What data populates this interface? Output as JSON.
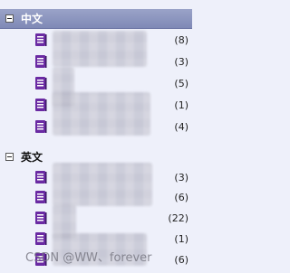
{
  "groups": [
    {
      "label": "中文",
      "selected": true,
      "items": [
        {
          "count": "(8)"
        },
        {
          "count": "(3)"
        },
        {
          "count": "(5)"
        },
        {
          "count": "(1)"
        },
        {
          "count": "(4)"
        }
      ]
    },
    {
      "label": "英文",
      "selected": false,
      "items": [
        {
          "count": "(3)"
        },
        {
          "count": "(6)"
        },
        {
          "count": "(22)"
        },
        {
          "count": "(1)"
        },
        {
          "count": "(6)"
        }
      ]
    }
  ],
  "watermark": "CSDN @WW、forever",
  "colors": {
    "background": "#eef0fa",
    "header_selected": "#8a93bf",
    "icon": "#6a2aa3"
  },
  "icons": {
    "toggle": "collapse-minus-icon",
    "item": "book-icon"
  }
}
